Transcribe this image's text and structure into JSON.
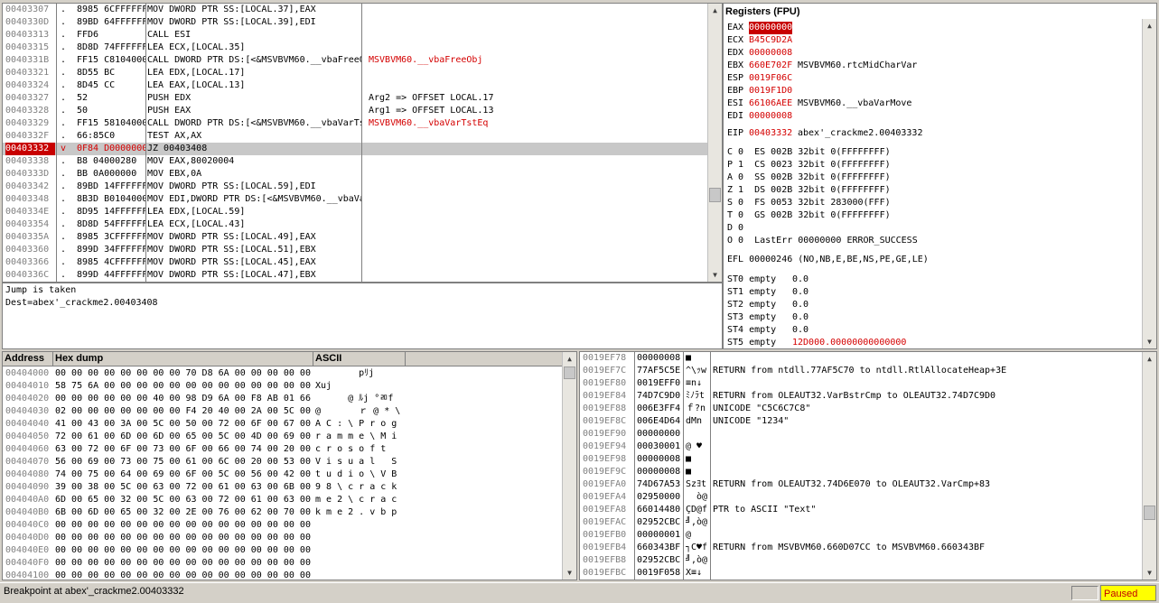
{
  "disasm": {
    "rows": [
      {
        "addr": "00403307",
        "mark": ".",
        "hex": "8985 6CFFFFFF",
        "instr": "MOV DWORD PTR SS:[LOCAL.37],EAX",
        "comment": ""
      },
      {
        "addr": "0040330D",
        "mark": ".",
        "hex": "89BD 64FFFFFF",
        "instr": "MOV DWORD PTR SS:[LOCAL.39],EDI",
        "comment": ""
      },
      {
        "addr": "00403313",
        "mark": ".",
        "hex": "FFD6",
        "instr": "CALL ESI",
        "comment": ""
      },
      {
        "addr": "00403315",
        "mark": ".",
        "hex": "8D8D 74FFFFFF",
        "instr": "LEA ECX,[LOCAL.35]",
        "comment": ""
      },
      {
        "addr": "0040331B",
        "mark": ".",
        "hex": "FF15 C8104000",
        "instr": "CALL DWORD PTR DS:[<&MSVBVM60.__vbaFreeO",
        "comment": "MSVBVM60.__vbaFreeObj"
      },
      {
        "addr": "00403321",
        "mark": ".",
        "hex": "8D55 BC",
        "instr": "LEA EDX,[LOCAL.17]",
        "comment": ""
      },
      {
        "addr": "00403324",
        "mark": ".",
        "hex": "8D45 CC",
        "instr": "LEA EAX,[LOCAL.13]",
        "comment": ""
      },
      {
        "addr": "00403327",
        "mark": ".",
        "hex": "52",
        "instr": "PUSH EDX",
        "comment": "Arg2 => OFFSET LOCAL.17"
      },
      {
        "addr": "00403328",
        "mark": ".",
        "hex": "50",
        "instr": "PUSH EAX",
        "comment": "Arg1 => OFFSET LOCAL.13"
      },
      {
        "addr": "00403329",
        "mark": ".",
        "hex": "FF15 58104000",
        "instr": "CALL DWORD PTR DS:[<&MSVBVM60.__vbaVarTs",
        "comment": "MSVBVM60.__vbaVarTstEq"
      },
      {
        "addr": "0040332F",
        "mark": ".",
        "hex": "66:85C0",
        "instr": "TEST AX,AX",
        "comment": ""
      },
      {
        "addr": "00403332",
        "mark": "v",
        "hex": "0F84 D0000000",
        "instr": "JZ 00403408",
        "comment": ""
      },
      {
        "addr": "00403338",
        "mark": ".",
        "hex": "B8 04000280",
        "instr": "MOV EAX,80020004",
        "comment": ""
      },
      {
        "addr": "0040333D",
        "mark": ".",
        "hex": "BB 0A000000",
        "instr": "MOV EBX,0A",
        "comment": ""
      },
      {
        "addr": "00403342",
        "mark": ".",
        "hex": "89BD 14FFFFFF",
        "instr": "MOV DWORD PTR SS:[LOCAL.59],EDI",
        "comment": ""
      },
      {
        "addr": "00403348",
        "mark": ".",
        "hex": "8B3D B0104000",
        "instr": "MOV EDI,DWORD PTR DS:[<&MSVBVM60.__vbaVa",
        "comment": ""
      },
      {
        "addr": "0040334E",
        "mark": ".",
        "hex": "8D95 14FFFFFF",
        "instr": "LEA EDX,[LOCAL.59]",
        "comment": ""
      },
      {
        "addr": "00403354",
        "mark": ".",
        "hex": "8D8D 54FFFFFF",
        "instr": "LEA ECX,[LOCAL.43]",
        "comment": ""
      },
      {
        "addr": "0040335A",
        "mark": ".",
        "hex": "8985 3CFFFFFF",
        "instr": "MOV DWORD PTR SS:[LOCAL.49],EAX",
        "comment": ""
      },
      {
        "addr": "00403360",
        "mark": ".",
        "hex": "899D 34FFFFFF",
        "instr": "MOV DWORD PTR SS:[LOCAL.51],EBX",
        "comment": ""
      },
      {
        "addr": "00403366",
        "mark": ".",
        "hex": "8985 4CFFFFFF",
        "instr": "MOV DWORD PTR SS:[LOCAL.45],EAX",
        "comment": ""
      },
      {
        "addr": "0040336C",
        "mark": ".",
        "hex": "899D 44FFFFFF",
        "instr": "MOV DWORD PTR SS:[LOCAL.47],EBX",
        "comment": ""
      }
    ]
  },
  "info": {
    "line1": "Jump is taken",
    "line2": "Dest=abex'_crackme2.00403408"
  },
  "registers": {
    "title": "Registers (FPU)",
    "lines": [
      {
        "label": "EAX",
        "value": "00000000",
        "extra": "",
        "style": "hl"
      },
      {
        "label": "ECX",
        "value": "B45C9D2A",
        "extra": "",
        "style": "red"
      },
      {
        "label": "EDX",
        "value": "00000008",
        "extra": "",
        "style": "red"
      },
      {
        "label": "EBX",
        "value": "660E702F",
        "extra": "MSVBVM60.rtcMidCharVar",
        "style": "red"
      },
      {
        "label": "ESP",
        "value": "0019F06C",
        "extra": "",
        "style": "red"
      },
      {
        "label": "EBP",
        "value": "0019F1D0",
        "extra": "",
        "style": "red"
      },
      {
        "label": "ESI",
        "value": "66106AEE",
        "extra": "MSVBVM60.__vbaVarMove",
        "style": "red"
      },
      {
        "label": "EDI",
        "value": "00000008",
        "extra": "",
        "style": "red"
      }
    ],
    "eip": {
      "label": "EIP",
      "value": "00403332",
      "extra": "abex'_crackme2.00403332"
    },
    "flags": [
      "C 0  ES 002B 32bit 0(FFFFFFFF)",
      "P 1  CS 0023 32bit 0(FFFFFFFF)",
      "A 0  SS 002B 32bit 0(FFFFFFFF)",
      "Z 1  DS 002B 32bit 0(FFFFFFFF)",
      "S 0  FS 0053 32bit 283000(FFF)",
      "T 0  GS 002B 32bit 0(FFFFFFFF)",
      "D 0",
      "O 0  LastErr 00000000 ERROR_SUCCESS"
    ],
    "efl": "EFL 00000246 (NO,NB,E,BE,NS,PE,GE,LE)",
    "fpu": [
      {
        "label": "ST0 empty",
        "value": "0.0",
        "style": ""
      },
      {
        "label": "ST1 empty",
        "value": "0.0",
        "style": ""
      },
      {
        "label": "ST2 empty",
        "value": "0.0",
        "style": ""
      },
      {
        "label": "ST3 empty",
        "value": "0.0",
        "style": ""
      },
      {
        "label": "ST4 empty",
        "value": "0.0",
        "style": ""
      },
      {
        "label": "ST5 empty",
        "value": "12D000.00000000000000",
        "style": "red"
      }
    ]
  },
  "dump": {
    "headers": {
      "address": "Address",
      "hex": "Hex dump",
      "ascii": "ASCII"
    },
    "rows": [
      {
        "addr": "00404000",
        "hex": "00 00 00 00 00 00 00 00 70 D8 6A 00 00 00 00 00",
        "ascii": "        pﾘj     "
      },
      {
        "addr": "00404010",
        "hex": "58 75 6A 00 00 00 00 00 00 00 00 00 00 00 00 00",
        "ascii": "Xuj             "
      },
      {
        "addr": "00404020",
        "hex": "00 00 00 00 00 00 40 00 98 D9 6A 00 F8 AB 01 66",
        "ascii": "      @ ﾙj °ﾫf"
      },
      {
        "addr": "00404030",
        "hex": "02 00 00 00 00 00 00 00 F4 20 40 00 2A 00 5C 00",
        "ascii": "@       ｒ @ * \\ "
      },
      {
        "addr": "00404040",
        "hex": "41 00 43 00 3A 00 5C 00 50 00 72 00 6F 00 67 00",
        "ascii": "A C : \\ P r o g "
      },
      {
        "addr": "00404050",
        "hex": "72 00 61 00 6D 00 6D 00 65 00 5C 00 4D 00 69 00",
        "ascii": "r a m m e \\ M i "
      },
      {
        "addr": "00404060",
        "hex": "63 00 72 00 6F 00 73 00 6F 00 66 00 74 00 20 00",
        "ascii": "c r o s o f t   "
      },
      {
        "addr": "00404070",
        "hex": "56 00 69 00 73 00 75 00 61 00 6C 00 20 00 53 00",
        "ascii": "V i s u a l   S "
      },
      {
        "addr": "00404080",
        "hex": "74 00 75 00 64 00 69 00 6F 00 5C 00 56 00 42 00",
        "ascii": "t u d i o \\ V B "
      },
      {
        "addr": "00404090",
        "hex": "39 00 38 00 5C 00 63 00 72 00 61 00 63 00 6B 00",
        "ascii": "9 8 \\ c r a c k "
      },
      {
        "addr": "004040A0",
        "hex": "6D 00 65 00 32 00 5C 00 63 00 72 00 61 00 63 00",
        "ascii": "m e 2 \\ c r a c "
      },
      {
        "addr": "004040B0",
        "hex": "6B 00 6D 00 65 00 32 00 2E 00 76 00 62 00 70 00",
        "ascii": "k m e 2 . v b p "
      },
      {
        "addr": "004040C0",
        "hex": "00 00 00 00 00 00 00 00 00 00 00 00 00 00 00 00",
        "ascii": ""
      },
      {
        "addr": "004040D0",
        "hex": "00 00 00 00 00 00 00 00 00 00 00 00 00 00 00 00",
        "ascii": ""
      },
      {
        "addr": "004040E0",
        "hex": "00 00 00 00 00 00 00 00 00 00 00 00 00 00 00 00",
        "ascii": ""
      },
      {
        "addr": "004040F0",
        "hex": "00 00 00 00 00 00 00 00 00 00 00 00 00 00 00 00",
        "ascii": ""
      },
      {
        "addr": "00404100",
        "hex": "00 00 00 00 00 00 00 00 00 00 00 00 00 00 00 00",
        "ascii": ""
      }
    ]
  },
  "stack": {
    "rows": [
      {
        "addr": "0019EF78",
        "val": "00000008",
        "ascii": "■",
        "comment": ""
      },
      {
        "addr": "0019EF7C",
        "val": "77AF5C5E",
        "ascii": "^\\ｯw",
        "comment": "RETURN from ntdll.77AF5C70 to ntdll.RtlAllocateHeap+3E"
      },
      {
        "addr": "0019EF80",
        "val": "0019EFF0",
        "ascii": "≡n↓",
        "comment": ""
      },
      {
        "addr": "0019EF84",
        "val": "74D7C9D0",
        "ascii": "ﾐﾉﾗt",
        "comment": "RETURN from OLEAUT32.VarBstrCmp to OLEAUT32.74D7C9D0"
      },
      {
        "addr": "0019EF88",
        "val": "006E3FF4",
        "ascii": "ｆ?n",
        "comment": "UNICODE \"C5C6C7C8\""
      },
      {
        "addr": "0019EF8C",
        "val": "006E4D64",
        "ascii": "dMn",
        "comment": "UNICODE \"1234\""
      },
      {
        "addr": "0019EF90",
        "val": "00000000",
        "ascii": "",
        "comment": ""
      },
      {
        "addr": "0019EF94",
        "val": "00030001",
        "ascii": "@ ♥",
        "comment": ""
      },
      {
        "addr": "0019EF98",
        "val": "00000008",
        "ascii": "■",
        "comment": ""
      },
      {
        "addr": "0019EF9C",
        "val": "00000008",
        "ascii": "■",
        "comment": ""
      },
      {
        "addr": "0019EFA0",
        "val": "74D67A53",
        "ascii": "Szﾖt",
        "comment": "RETURN from OLEAUT32.74D6E070 to OLEAUT32.VarCmp+83"
      },
      {
        "addr": "0019EFA4",
        "val": "02950000",
        "ascii": "  ò@",
        "comment": ""
      },
      {
        "addr": "0019EFA8",
        "val": "66014480",
        "ascii": "ÇD@f",
        "comment": "PTR to ASCII \"Text\""
      },
      {
        "addr": "0019EFAC",
        "val": "02952CBC",
        "ascii": "╝,ò@",
        "comment": ""
      },
      {
        "addr": "0019EFB0",
        "val": "00000001",
        "ascii": "@",
        "comment": ""
      },
      {
        "addr": "0019EFB4",
        "val": "660343BF",
        "ascii": "┐C♥f",
        "comment": "RETURN from MSVBVM60.660D07CC to MSVBVM60.660343BF"
      },
      {
        "addr": "0019EFB8",
        "val": "02952CBC",
        "ascii": "╝,ò@",
        "comment": ""
      },
      {
        "addr": "0019EFBC",
        "val": "0019F058",
        "ascii": "X≡↓",
        "comment": ""
      }
    ]
  },
  "status": {
    "text": "Breakpoint at abex'_crackme2.00403332",
    "state": "Paused"
  }
}
